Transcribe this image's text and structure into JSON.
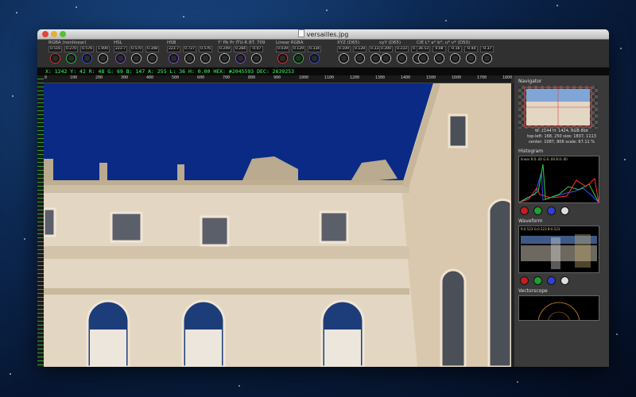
{
  "window": {
    "title": "versailles.jpg"
  },
  "groups": [
    {
      "label": "RGBA (nonlinear)",
      "values": [
        "0.516",
        "0.270",
        "0.576",
        "1.000"
      ],
      "colors": [
        "#e03030",
        "#30c040",
        "#3050e0",
        "#bbbbbb"
      ]
    },
    {
      "label": "HSL",
      "values": [
        "223.7",
        "0.570",
        "0.348"
      ],
      "colors": [
        "#8050d0",
        "#bbbbbb",
        "#bbbbbb"
      ]
    },
    {
      "label": "HSB",
      "values": [
        "223.7",
        "0.727",
        "0.576"
      ],
      "colors": [
        "#8050d0",
        "#bbbbbb",
        "#bbbbbb"
      ]
    },
    {
      "label": "Y' Pb Pr ITU-R BT. 709",
      "values": [
        "0.249",
        "0.284",
        "-0.07"
      ],
      "colors": [
        "#bbbbbb",
        "#8050d0",
        "#bbbbbb"
      ]
    },
    {
      "label": "Linear RGBA",
      "values": [
        "0.039",
        "0.129",
        "0.334"
      ],
      "colors": [
        "#e03030",
        "#30c040",
        "#3050e0"
      ]
    },
    {
      "label": "XYZ (D65)",
      "values": [
        "0.109",
        "0.128",
        "0.333"
      ],
      "colors": [
        "#bbbbbb",
        "#bbbbbb",
        "#bbbbbb"
      ]
    },
    {
      "label": "xyY (D65)",
      "values": [
        "0.200",
        "0.233",
        "0.128"
      ],
      "colors": [
        "#bbbbbb",
        "#bbbbbb",
        "#bbbbbb"
      ]
    },
    {
      "label": "CIE L* a* b*, u* v* (D50)",
      "values": [
        "36.53",
        "0.08",
        "-0.16",
        "-0.44",
        "-0.37"
      ],
      "colors": [
        "#bbbbbb",
        "#bbbbbb",
        "#bbbbbb",
        "#bbbbbb",
        "#bbbbbb"
      ]
    }
  ],
  "infobar": "X: 1242  Y: 42  R: 48  G: 69  B: 147  A: 255  L: 36  H: 0.00  HEX: #2045593  DEC: 2639253",
  "ruler": [
    "0",
    "100",
    "200",
    "300",
    "400",
    "500",
    "600",
    "700",
    "800",
    "900",
    "1000",
    "1100",
    "1200",
    "1300",
    "1400",
    "1500",
    "1600",
    "1700",
    "1800",
    "1900"
  ],
  "navigator": {
    "title": "Navigator",
    "info1": "W: 2144  H: 1424, RGB 8bit",
    "info2": "top-left: 168, 250   size: 1837, 1113",
    "info3": "center: 1087, 806    scale: 67.11 %"
  },
  "histogram": {
    "title": "Histogram",
    "header": "linear  R:0-.00 G:0-.00 B:0-.00"
  },
  "waveform": {
    "title": "Waveform",
    "header": "R:0.523  G:0.523  B:0.523"
  },
  "vectorscope": {
    "title": "Vectorscope"
  },
  "sky_color": "#0a2a86"
}
